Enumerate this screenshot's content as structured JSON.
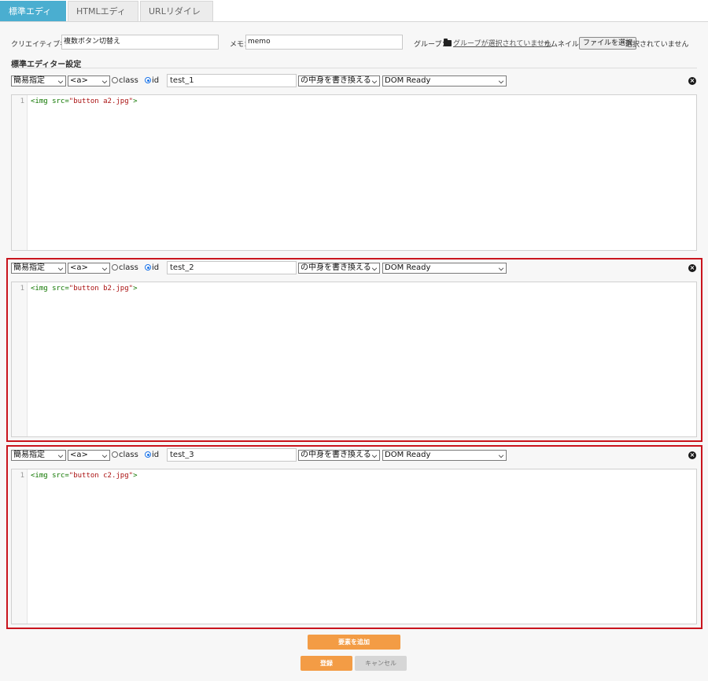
{
  "tabs": [
    {
      "label": "標準エディター",
      "active": true
    },
    {
      "label": "HTMLエディター",
      "active": false
    },
    {
      "label": "URLリダイレクト",
      "active": false
    }
  ],
  "form": {
    "creative_label": "クリエイティブ名：",
    "creative_value": "複数ボタン切替え",
    "memo_label": "メモ：",
    "memo_value": "memo",
    "group_label": "グループ：",
    "group_link": "グループが選択されていません",
    "thumb_label": "サムネイル：",
    "file_button": "ファイルを選択",
    "file_status": "選択されていません"
  },
  "section_title": "標準エディター設定",
  "blocks": [
    {
      "mode": "簡易指定",
      "tag": "<a>",
      "class_label": "class",
      "id_label": "id",
      "selected": "id",
      "id_value": "test_1",
      "action": "の中身を書き換える",
      "timing": "DOM Ready",
      "line_no": "1",
      "code_tag": "<img ",
      "code_attr": "src=",
      "code_str": "\"button a2.jpg\"",
      "code_end": ">",
      "highlighted": false
    },
    {
      "mode": "簡易指定",
      "tag": "<a>",
      "class_label": "class",
      "id_label": "id",
      "selected": "id",
      "id_value": "test_2",
      "action": "の中身を書き換える",
      "timing": "DOM Ready",
      "line_no": "1",
      "code_tag": "<img ",
      "code_attr": "src=",
      "code_str": "\"button b2.jpg\"",
      "code_end": ">",
      "highlighted": true
    },
    {
      "mode": "簡易指定",
      "tag": "<a>",
      "class_label": "class",
      "id_label": "id",
      "selected": "id",
      "id_value": "test_3",
      "action": "の中身を書き換える",
      "timing": "DOM Ready",
      "line_no": "1",
      "code_tag": "<img ",
      "code_attr": "src=",
      "code_str": "\"button c2.jpg\"",
      "code_end": ">",
      "highlighted": true
    }
  ],
  "buttons": {
    "add_element": "要素を追加",
    "register": "登録",
    "cancel": "キャンセル"
  },
  "colors": {
    "tab_active": "#4aaed0",
    "highlight_border": "#c9141d",
    "primary_button": "#f39c45"
  }
}
